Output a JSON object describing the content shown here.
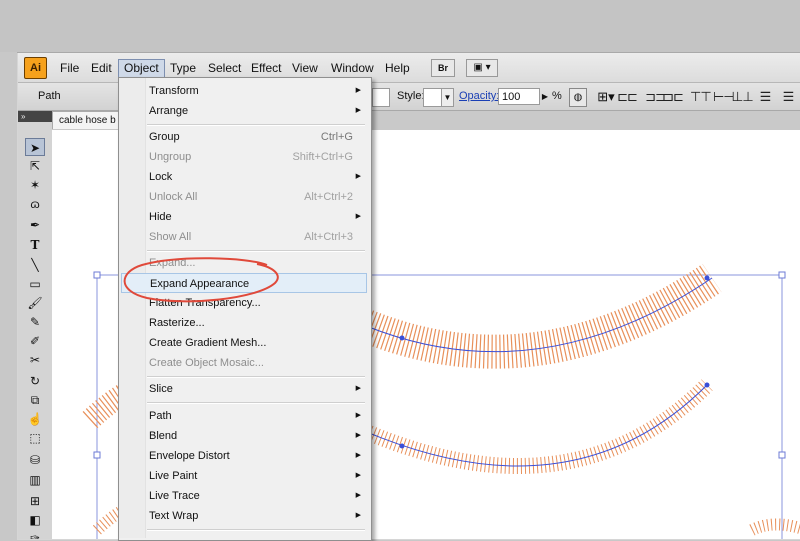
{
  "app": {
    "logo": "Ai"
  },
  "menubar": {
    "items": [
      "File",
      "Edit",
      "Object",
      "Type",
      "Select",
      "Effect",
      "View",
      "Window",
      "Help"
    ],
    "bridge": "Br"
  },
  "control_bar": {
    "selection_type": "Path",
    "style_label": "Style:",
    "opacity_label": "Opacity:",
    "opacity_value": "100",
    "opacity_unit": "%"
  },
  "document": {
    "tab_title": "cable hose b"
  },
  "object_menu": {
    "items": [
      {
        "label": "Transform",
        "shortcut": "",
        "submenu": true,
        "enabled": true
      },
      {
        "label": "Arrange",
        "shortcut": "",
        "submenu": true,
        "enabled": true
      },
      {
        "label": "Group",
        "shortcut": "Ctrl+G",
        "submenu": false,
        "enabled": true
      },
      {
        "label": "Ungroup",
        "shortcut": "Shift+Ctrl+G",
        "submenu": false,
        "enabled": false
      },
      {
        "label": "Lock",
        "shortcut": "",
        "submenu": true,
        "enabled": true
      },
      {
        "label": "Unlock All",
        "shortcut": "Alt+Ctrl+2",
        "submenu": false,
        "enabled": false
      },
      {
        "label": "Hide",
        "shortcut": "",
        "submenu": true,
        "enabled": true
      },
      {
        "label": "Show All",
        "shortcut": "Alt+Ctrl+3",
        "submenu": false,
        "enabled": false
      },
      {
        "label": "Expand...",
        "shortcut": "",
        "submenu": false,
        "enabled": false
      },
      {
        "label": "Expand Appearance",
        "shortcut": "",
        "submenu": false,
        "enabled": true,
        "highlighted": true
      },
      {
        "label": "Flatten Transparency...",
        "shortcut": "",
        "submenu": false,
        "enabled": true
      },
      {
        "label": "Rasterize...",
        "shortcut": "",
        "submenu": false,
        "enabled": true
      },
      {
        "label": "Create Gradient Mesh...",
        "shortcut": "",
        "submenu": false,
        "enabled": true
      },
      {
        "label": "Create Object Mosaic...",
        "shortcut": "",
        "submenu": false,
        "enabled": false
      },
      {
        "label": "Slice",
        "shortcut": "",
        "submenu": true,
        "enabled": true
      },
      {
        "label": "Path",
        "shortcut": "",
        "submenu": true,
        "enabled": true
      },
      {
        "label": "Blend",
        "shortcut": "",
        "submenu": true,
        "enabled": true
      },
      {
        "label": "Envelope Distort",
        "shortcut": "",
        "submenu": true,
        "enabled": true
      },
      {
        "label": "Live Paint",
        "shortcut": "",
        "submenu": true,
        "enabled": true
      },
      {
        "label": "Live Trace",
        "shortcut": "",
        "submenu": true,
        "enabled": true
      },
      {
        "label": "Text Wrap",
        "shortcut": "",
        "submenu": true,
        "enabled": true
      }
    ]
  },
  "tools": [
    "selection-tool",
    "direct-selection-tool",
    "magic-wand-tool",
    "lasso-tool",
    "pen-tool",
    "type-tool",
    "line-tool",
    "rectangle-tool",
    "paintbrush-tool",
    "pencil-tool",
    "blob-brush-tool",
    "scissors-tool",
    "rotate-tool",
    "scale-tool",
    "warp-tool",
    "free-transform-tool",
    "symbol-sprayer-tool",
    "graph-tool",
    "mesh-tool",
    "gradient-tool",
    "eyedropper-tool"
  ],
  "colors": {
    "hose_stroke": "#e8905a",
    "path_blue": "#3a4fd8",
    "menu_highlight": "#e3eef8",
    "annotation_red": "#e0493a"
  }
}
